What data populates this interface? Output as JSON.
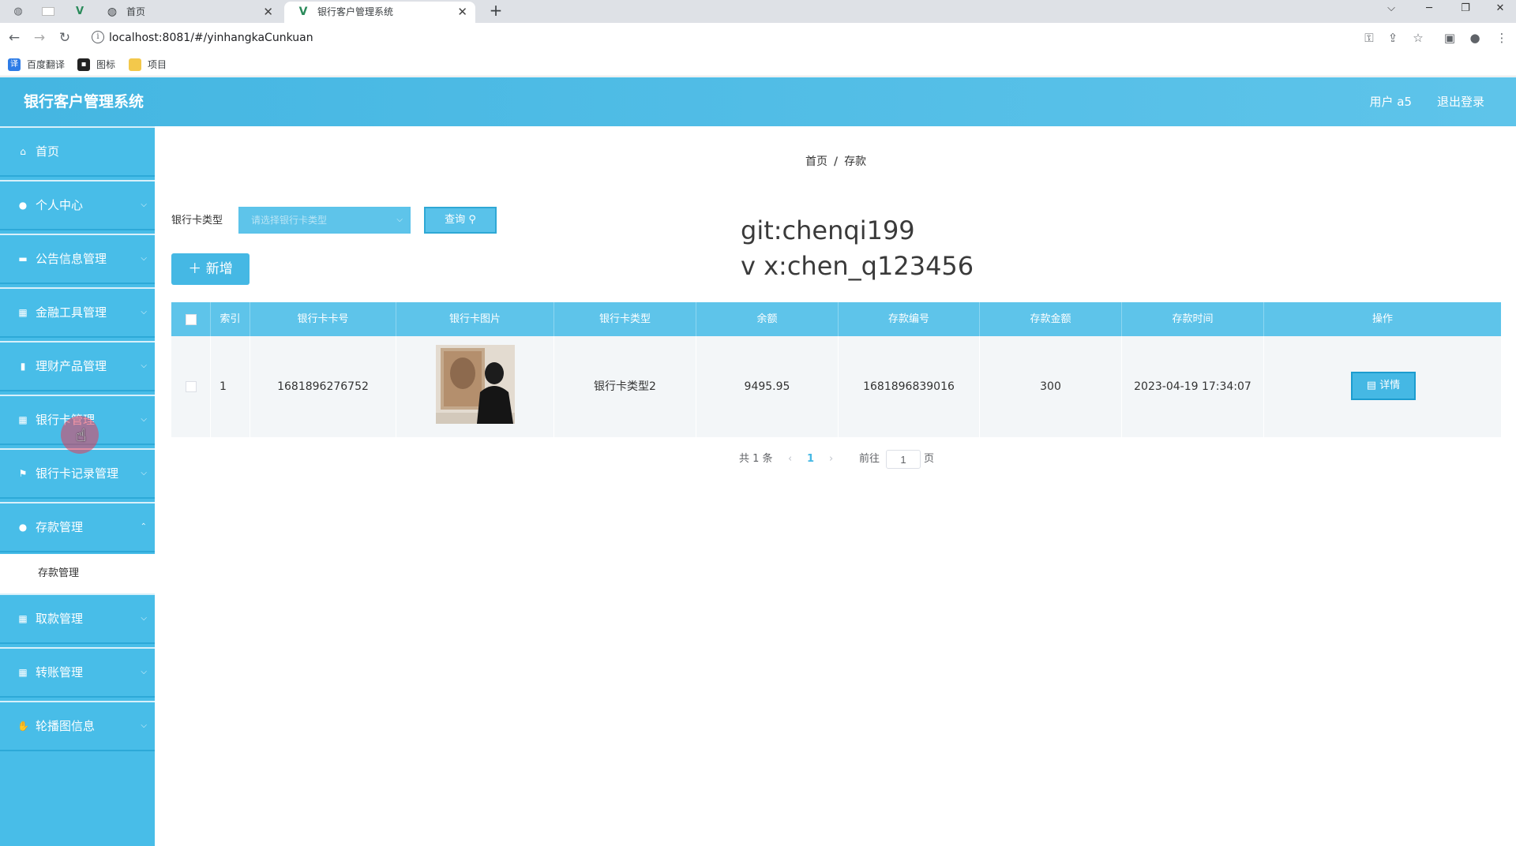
{
  "browser": {
    "tabs": [
      {
        "label": "首页",
        "active": false
      },
      {
        "label": "银行客户管理系统",
        "active": true
      }
    ],
    "url": "localhost:8081/#/yinhangkaCunkuan",
    "bookmarks": [
      "百度翻译",
      "图标",
      "项目"
    ]
  },
  "header": {
    "title": "银行客户管理系统",
    "user": "用户 a5",
    "logout": "退出登录"
  },
  "sidebar": {
    "items": [
      {
        "label": "首页",
        "icon": "home-icon"
      },
      {
        "label": "个人中心",
        "icon": "user-icon"
      },
      {
        "label": "公告信息管理",
        "icon": "message-icon"
      },
      {
        "label": "金融工具管理",
        "icon": "grid-icon"
      },
      {
        "label": "理财产品管理",
        "icon": "chart-icon"
      },
      {
        "label": "银行卡管理",
        "icon": "grid-icon"
      },
      {
        "label": "银行卡记录管理",
        "icon": "flag-icon"
      },
      {
        "label": "存款管理",
        "icon": "user-icon"
      },
      {
        "label": "取款管理",
        "icon": "grid-icon"
      },
      {
        "label": "转账管理",
        "icon": "grid-icon"
      },
      {
        "label": "轮播图信息",
        "icon": "thumb-icon"
      }
    ],
    "submenu_label": "存款管理"
  },
  "breadcrumb": [
    "首页",
    "存款"
  ],
  "filter": {
    "label": "银行卡类型",
    "placeholder": "请选择银行卡类型",
    "query_label": "查询"
  },
  "add_label": "新增",
  "watermark": {
    "line1": "git:chenqi199",
    "line2": "v x:chen_q123456"
  },
  "table": {
    "columns": [
      "索引",
      "银行卡卡号",
      "银行卡图片",
      "银行卡类型",
      "余额",
      "存款编号",
      "存款金额",
      "存款时间",
      "操作"
    ],
    "rows": [
      {
        "index": "1",
        "card_number": "1681896276752",
        "card_type": "银行卡类型2",
        "balance": "9495.95",
        "deposit_no": "1681896839016",
        "amount": "300",
        "time": "2023-04-19 17:34:07",
        "action": "详情"
      }
    ]
  },
  "pagination": {
    "total": "共 1 条",
    "current": "1",
    "goto": "前往",
    "page_value": "1",
    "page_suffix": "页"
  },
  "colors": {
    "primary": "#48bde8",
    "header": "#44b6e2"
  }
}
